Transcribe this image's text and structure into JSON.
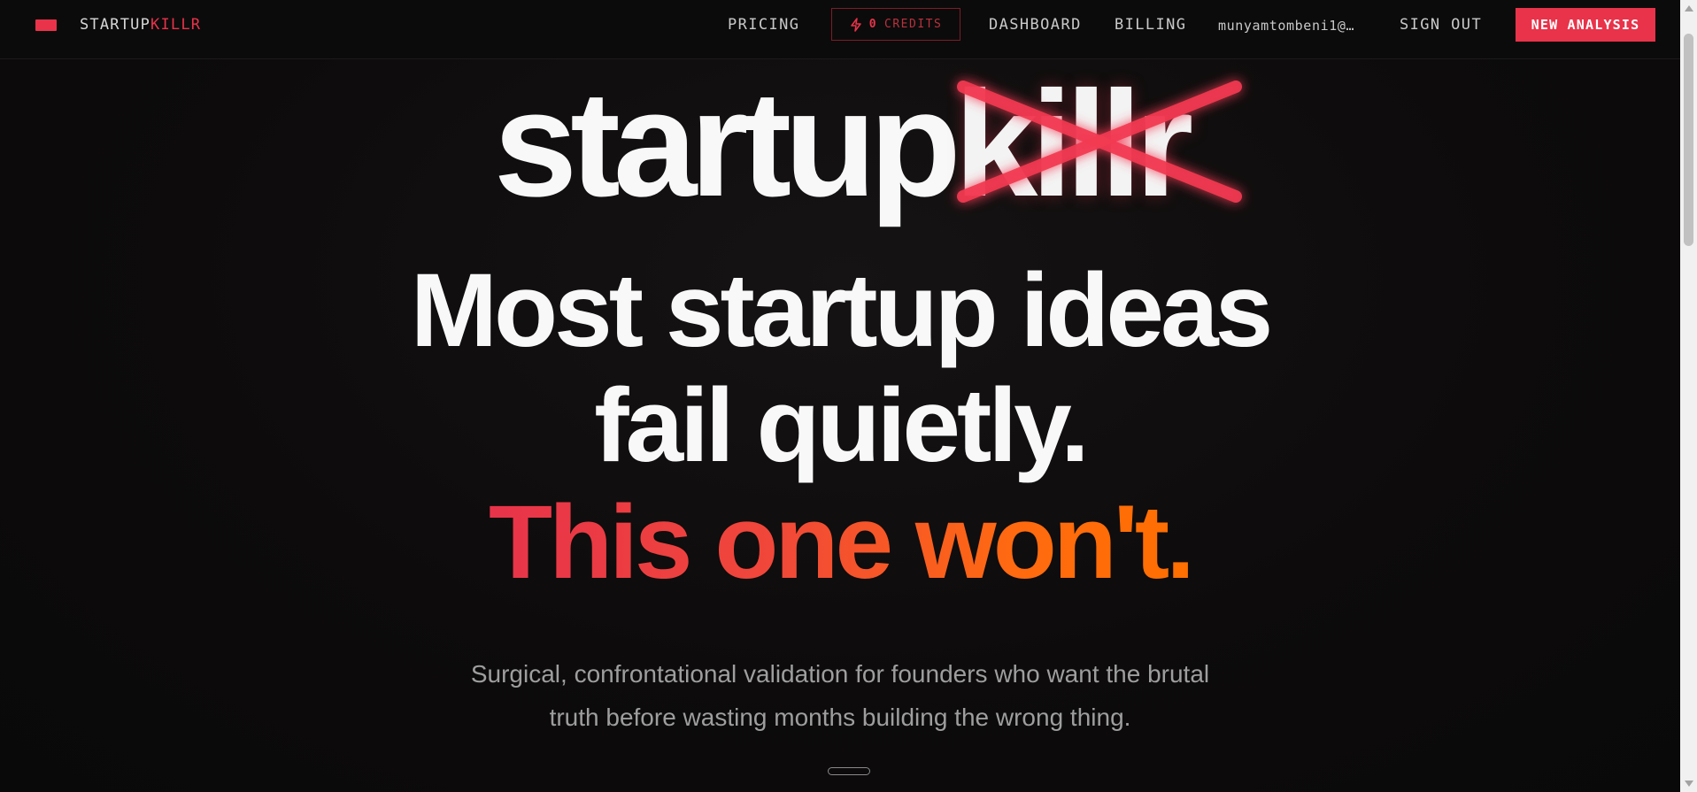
{
  "nav": {
    "logo_prefix": "STARTUP",
    "logo_accent": "KILLR",
    "links": {
      "pricing": "PRICING",
      "dashboard": "DASHBOARD",
      "billing": "BILLING",
      "user": "munyamtombeni1@…",
      "sign_out": "SIGN OUT"
    },
    "credits": {
      "count": "0",
      "label": "CREDITS",
      "icon": "lightning-icon"
    },
    "new_analysis": "NEW ANALYSIS"
  },
  "hero": {
    "brand_plain": "startup",
    "brand_crossed": "killr",
    "line1": "Most startup ideas",
    "line2": "fail quietly.",
    "line3": "This one won't.",
    "subtitle_line1": "Surgical, confrontational validation for founders who want the brutal",
    "subtitle_line2": "truth before wasting months building the wrong thing."
  },
  "colors": {
    "accent": "#e8334a",
    "accent_orange": "#ff6f00",
    "background": "#0b0a0a"
  }
}
